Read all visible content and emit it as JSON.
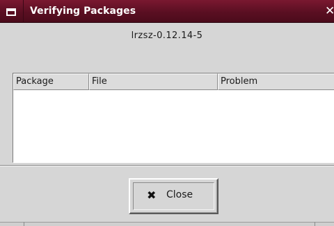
{
  "window": {
    "title": "Verifying Packages",
    "close_glyph": "✕",
    "menu_icon": "window-menu-icon"
  },
  "package": {
    "name": "lrzsz-0.12.14-5"
  },
  "table": {
    "columns": [
      "Package",
      "File",
      "Problem"
    ],
    "rows": []
  },
  "close_button": {
    "icon_glyph": "✖",
    "label": "Close"
  },
  "colors": {
    "titlebar": "#5a0f22",
    "background": "#d6d6d6",
    "table_body": "#ffffff"
  }
}
